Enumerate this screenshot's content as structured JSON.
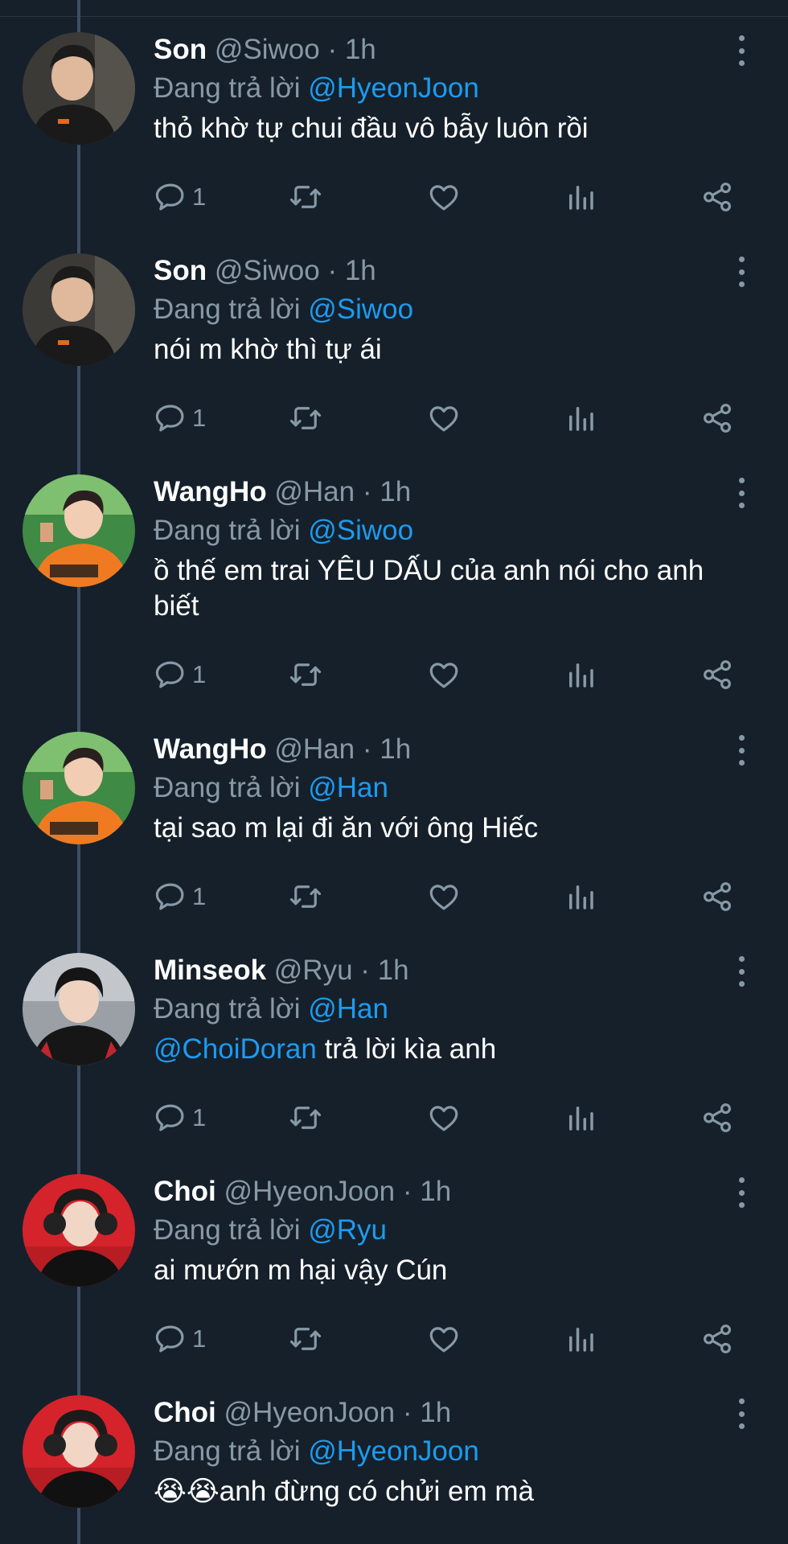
{
  "tweets": [
    {
      "name": "Son",
      "handle": "@Siwoo",
      "separator": "·",
      "time": "1h",
      "reply_prefix": "Đang trả lời",
      "reply_to": "@HyeonJoon",
      "text": "thỏ khờ tự chui đầu vô bẫy luôn rồi",
      "reply_count": "1"
    },
    {
      "name": "Son",
      "handle": "@Siwoo",
      "separator": "·",
      "time": "1h",
      "reply_prefix": "Đang trả lời",
      "reply_to": "@Siwoo",
      "text": "nói m khờ thì tự ái",
      "reply_count": "1"
    },
    {
      "name": "WangHo",
      "handle": "@Han",
      "separator": "·",
      "time": "1h",
      "reply_prefix": "Đang trả lời",
      "reply_to": "@Siwoo",
      "text": "ồ thế em trai YÊU DẤU của anh nói cho anh biết",
      "reply_count": "1"
    },
    {
      "name": "WangHo",
      "handle": "@Han",
      "separator": "·",
      "time": "1h",
      "reply_prefix": "Đang trả lời",
      "reply_to": "@Han",
      "text": "tại sao m lại đi ăn với ông Hiếc",
      "reply_count": "1"
    },
    {
      "name": "Minseok",
      "handle": "@Ryu",
      "separator": "·",
      "time": "1h",
      "reply_prefix": "Đang trả lời",
      "reply_to": "@Han",
      "text_mention": "@ChoiDoran",
      "text": " trả lời kìa anh",
      "reply_count": "1"
    },
    {
      "name": "Choi",
      "handle": "@HyeonJoon",
      "separator": "·",
      "time": "1h",
      "reply_prefix": "Đang trả lời",
      "reply_to": "@Ryu",
      "text": "ai mướn m hại vậy Cún",
      "reply_count": "1"
    },
    {
      "name": "Choi",
      "handle": "@HyeonJoon",
      "separator": "·",
      "time": "1h",
      "reply_prefix": "Đang trả lời",
      "reply_to": "@HyeonJoon",
      "emoji": "😭😭",
      "text": "anh đừng có chửi em mà"
    }
  ],
  "icons": {
    "reply": "comment-icon",
    "retweet": "retweet-icon",
    "like": "heart-icon",
    "views": "views-icon",
    "share": "share-icon",
    "menu": "more-vertical-icon"
  },
  "colors": {
    "background": "#15202b",
    "text": "#ffffff",
    "muted": "#8899a6",
    "mention": "#1d9bf0"
  }
}
